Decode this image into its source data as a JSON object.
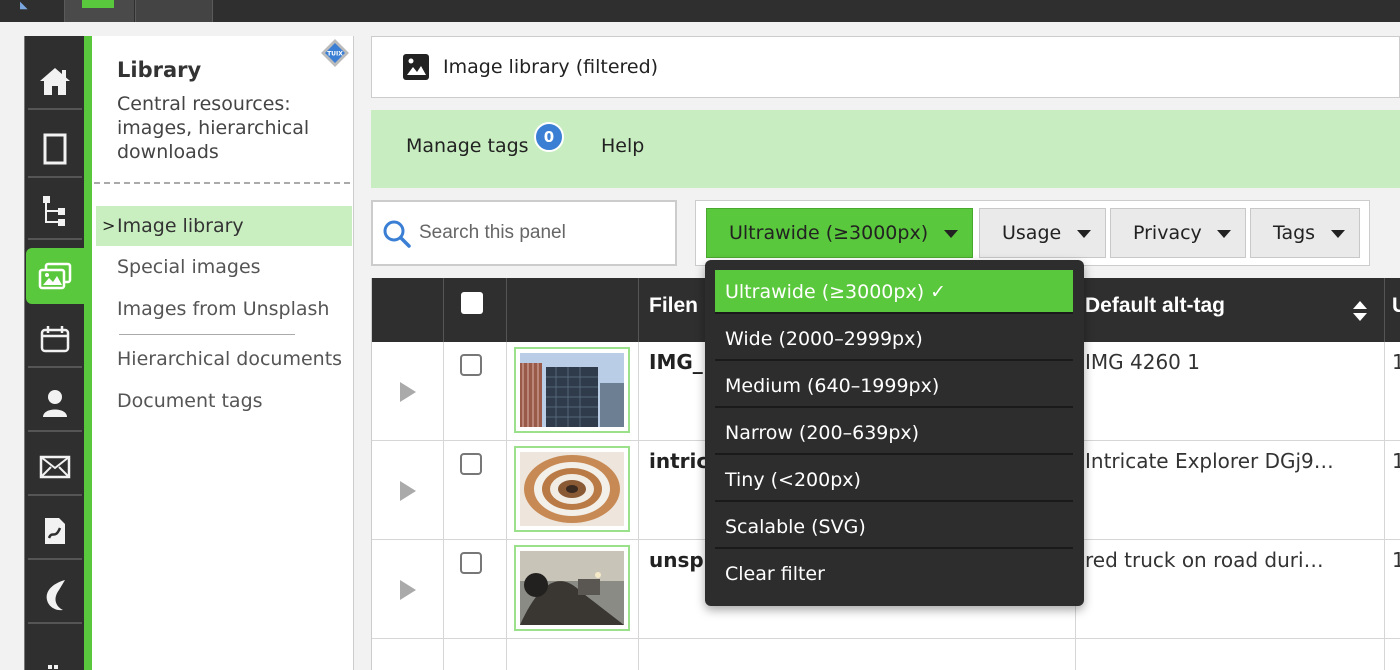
{
  "app": {
    "library_title": "Library",
    "library_description": "Central resources: images, hierarchical downloads",
    "badge_logo": "TUIX"
  },
  "sidebar": {
    "items": [
      {
        "label": "Image library",
        "active": true
      },
      {
        "label": "Special images"
      },
      {
        "label": "Images from Unsplash"
      },
      {
        "label": "Hierarchical documents"
      },
      {
        "label": "Document tags"
      }
    ]
  },
  "rail": {
    "icons": [
      "home-icon",
      "page-icon",
      "sitemap-icon",
      "images-icon",
      "calendar-icon",
      "user-icon",
      "mail-icon",
      "document-icon",
      "crocodile-icon",
      "grid-icon"
    ]
  },
  "header": {
    "title": "Image library (filtered)"
  },
  "toolbar": {
    "manage_tags": "Manage tags",
    "manage_tags_count": "0",
    "help": "Help"
  },
  "search": {
    "placeholder": "Search this panel"
  },
  "filters": {
    "size": "Ultrawide (≥3000px)",
    "usage": "Usage",
    "privacy": "Privacy",
    "tags": "Tags"
  },
  "table": {
    "columns": {
      "filename": "Filen",
      "alt": "Default alt-tag",
      "extra": "U"
    },
    "rows": [
      {
        "filename": "IMG_",
        "alt": "IMG 4260 1",
        "extra": "1"
      },
      {
        "filename": "intric",
        "alt": "Intricate Explorer DGj9…",
        "extra": "1"
      },
      {
        "filename": "unsp",
        "alt": "red truck on road duri…",
        "extra": "1"
      }
    ]
  },
  "dropdown": {
    "options": [
      "Ultrawide (≥3000px) ✓",
      "Wide (2000–2999px)",
      "Medium (640–1999px)",
      "Narrow (200–639px)",
      "Tiny (<200px)",
      "Scalable (SVG)",
      "Clear filter"
    ]
  },
  "colors": {
    "accent": "#5ac83c",
    "dark": "#2f2f2f",
    "toolbar_bg": "#c8edc0",
    "badge": "#3a7fd4"
  }
}
